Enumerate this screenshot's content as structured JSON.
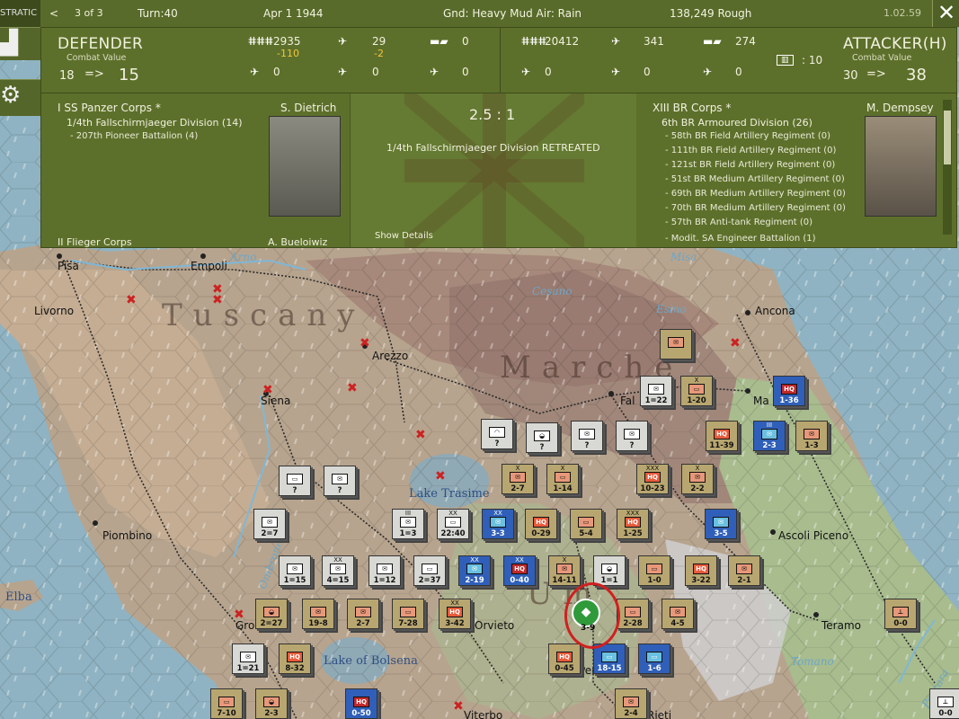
{
  "topbar": {
    "back": "<",
    "page": "3 of 3",
    "turn": "Turn:40",
    "date": "Apr 1 1944",
    "weather": "Gnd: Heavy Mud  Air: Rain",
    "hex": "138,249   Rough",
    "version": "1.02.59",
    "close": "✕",
    "left_tab": "STRATIC"
  },
  "defender": {
    "title": "DEFENDER",
    "cv_label": "Combat Value",
    "cv_from": "18",
    "arrow": "=>",
    "cv_to": "15",
    "inf": "2935",
    "inf_loss": "-110",
    "air1": "29",
    "air1_loss": "-2",
    "tank": "0",
    "r2a": "0",
    "r2b": "0",
    "r2c": "0"
  },
  "attacker": {
    "title": "ATTACKER(H)",
    "cv_label": "Combat Value",
    "cv_from": "30",
    "arrow": "=>",
    "cv_to": "38",
    "inf": "20412",
    "air1": "341",
    "tank": "274",
    "r2a": "0",
    "r2b": "0",
    "r2c": "0",
    "rail": ": 10"
  },
  "left": {
    "corps": "I SS Panzer Corps *",
    "commander": "S. Dietrich",
    "division": "1/4th Fallschirmjaeger Division (14)",
    "sub": "- 207th Pioneer Battalion (4)",
    "next": "II Flieger Corps",
    "next_cmd": "A. Bueloiwiz"
  },
  "middle": {
    "odds": "2.5 : 1",
    "result": "1/4th Fallschirmjaeger Division RETREATED",
    "details": "Show Details"
  },
  "right": {
    "corps": "XIII BR Corps *",
    "commander": "M. Dempsey",
    "division": "6th BR Armoured Division (26)",
    "subs": [
      "- 58th BR Field Artillery Regiment (0)",
      "- 111th BR Field Artillery Regiment (0)",
      "- 121st BR Field Artillery Regiment (0)",
      "- 51st BR Medium Artillery Regiment (0)",
      "- 69th BR Medium Artillery Regiment (0)",
      "- 70th BR Medium Artillery Regiment (0)",
      "- 57th BR Anti-tank Regiment (0)",
      "- Modit. SA Engineer Battalion (1)"
    ]
  },
  "map": {
    "regions": [
      "Tuscany",
      "Marche",
      "Um"
    ],
    "cities": [
      "Pisa",
      "Empoli",
      "Livorno",
      "Arezzo",
      "Siena",
      "Piombino",
      "Ancona",
      "Ascoli Piceno",
      "Teramo",
      "Orvieto",
      "Viterbo",
      "Rieti",
      "Fal",
      "Ma",
      "Gro",
      "Per"
    ],
    "water": [
      "Lake Trasime",
      "Lake of Bolsena",
      "Elba"
    ],
    "rivers": [
      "Arno",
      "Misa",
      "Cesano",
      "Esino",
      "Ombrone",
      "Pescara",
      "Tomano"
    ]
  },
  "counters": [
    {
      "side": "us",
      "sz": "",
      "sym": "✉",
      "val": ""
    },
    {
      "side": "ger",
      "sz": "",
      "sym": "✉",
      "val": "1=22"
    },
    {
      "side": "us",
      "sz": "X",
      "sym": "▭",
      "val": "1-20"
    },
    {
      "side": "blue",
      "sz": "",
      "sym": "HQ",
      "val": "1-36"
    },
    {
      "side": "ger",
      "sz": "",
      "sym": "◠",
      "val": "?"
    },
    {
      "side": "ger",
      "sz": "",
      "sym": "◒",
      "val": "?"
    },
    {
      "side": "ger",
      "sz": "",
      "sym": "✉",
      "val": "?"
    },
    {
      "side": "ger",
      "sz": "",
      "sym": "✉",
      "val": "?"
    },
    {
      "side": "us",
      "sz": "",
      "sym": "HQ",
      "val": "11-39"
    },
    {
      "side": "blue",
      "sz": "III",
      "sym": "✉",
      "val": "2-3"
    },
    {
      "side": "us",
      "sz": "",
      "sym": "✉",
      "val": "1-3"
    },
    {
      "side": "us",
      "sz": "X",
      "sym": "✉",
      "val": "2-7"
    },
    {
      "side": "us",
      "sz": "X",
      "sym": "▭",
      "val": "1-14"
    },
    {
      "side": "us",
      "sz": "XXX",
      "sym": "HQ",
      "val": "10-23"
    },
    {
      "side": "us",
      "sz": "X",
      "sym": "✉",
      "val": "2-2"
    },
    {
      "side": "ger",
      "sz": "",
      "sym": "▭",
      "val": "?"
    },
    {
      "side": "ger",
      "sz": "",
      "sym": "✉",
      "val": "?"
    },
    {
      "side": "ger",
      "sz": "",
      "sym": "✉",
      "val": "2=7"
    },
    {
      "side": "ger",
      "sz": "III",
      "sym": "✉",
      "val": "1=3"
    },
    {
      "side": "ger",
      "sz": "XX",
      "sym": "▭",
      "val": "22:40"
    },
    {
      "side": "blue",
      "sz": "XX",
      "sym": "✉",
      "val": "3-3"
    },
    {
      "side": "us",
      "sz": "",
      "sym": "HQ",
      "val": "0-29"
    },
    {
      "side": "us",
      "sz": "",
      "sym": "▭",
      "val": "5-4"
    },
    {
      "side": "us",
      "sz": "XXX",
      "sym": "HQ",
      "val": "1-25"
    },
    {
      "side": "blue",
      "sz": "",
      "sym": "✉",
      "val": "3-5"
    },
    {
      "side": "ger",
      "sz": "",
      "sym": "✉",
      "val": "1=15"
    },
    {
      "side": "ger",
      "sz": "XX",
      "sym": "✉",
      "val": "4=15"
    },
    {
      "side": "ger",
      "sz": "",
      "sym": "✉",
      "val": "1=12"
    },
    {
      "side": "ger",
      "sz": "",
      "sym": "▭",
      "val": "2=37"
    },
    {
      "side": "blue",
      "sz": "XX",
      "sym": "✉",
      "val": "2-19"
    },
    {
      "side": "blue",
      "sz": "XX",
      "sym": "HQ",
      "val": "0-40"
    },
    {
      "side": "us",
      "sz": "X",
      "sym": "✉",
      "val": "14-11"
    },
    {
      "side": "ger",
      "sz": "",
      "sym": "◒",
      "val": "1=1"
    },
    {
      "side": "us",
      "sz": "",
      "sym": "▭",
      "val": "1-0"
    },
    {
      "side": "us",
      "sz": "",
      "sym": "HQ",
      "val": "3-22"
    },
    {
      "side": "us",
      "sz": "",
      "sym": "✉",
      "val": "2-1"
    },
    {
      "side": "us",
      "sz": "",
      "sym": "◒",
      "val": "2=27"
    },
    {
      "side": "us",
      "sz": "",
      "sym": "✉",
      "val": "19-8"
    },
    {
      "side": "us",
      "sz": "",
      "sym": "✉",
      "val": "2-7"
    },
    {
      "side": "us",
      "sz": "",
      "sym": "▭",
      "val": "7-28"
    },
    {
      "side": "us",
      "sz": "XX",
      "sym": "HQ",
      "val": "3-42"
    },
    {
      "side": "us",
      "sz": "",
      "sym": "▭",
      "val": "2-28"
    },
    {
      "side": "us",
      "sz": "",
      "sym": "✉",
      "val": "4-5"
    },
    {
      "side": "us",
      "sz": "",
      "sym": "⊥",
      "val": "0-0"
    },
    {
      "side": "ger",
      "sz": "",
      "sym": "✉",
      "val": "1=21"
    },
    {
      "side": "us",
      "sz": "",
      "sym": "HQ",
      "val": "8-32"
    },
    {
      "side": "us",
      "sz": "",
      "sym": "HQ",
      "val": "0-45"
    },
    {
      "side": "blue",
      "sz": "",
      "sym": "▭",
      "val": "18-15"
    },
    {
      "side": "blue",
      "sz": "",
      "sym": "▭",
      "val": "1-6"
    },
    {
      "side": "us",
      "sz": "",
      "sym": "▭",
      "val": "7-10"
    },
    {
      "side": "us",
      "sz": "",
      "sym": "◒",
      "val": "2-3"
    },
    {
      "side": "blue",
      "sz": "",
      "sym": "HQ",
      "val": "0-50"
    },
    {
      "side": "us",
      "sz": "",
      "sym": "✉",
      "val": "2-4"
    },
    {
      "side": "ger",
      "sz": "",
      "sym": "⊥",
      "val": "0-0"
    }
  ],
  "selected_unit": {
    "val": "3-9",
    "sym": "◆"
  }
}
